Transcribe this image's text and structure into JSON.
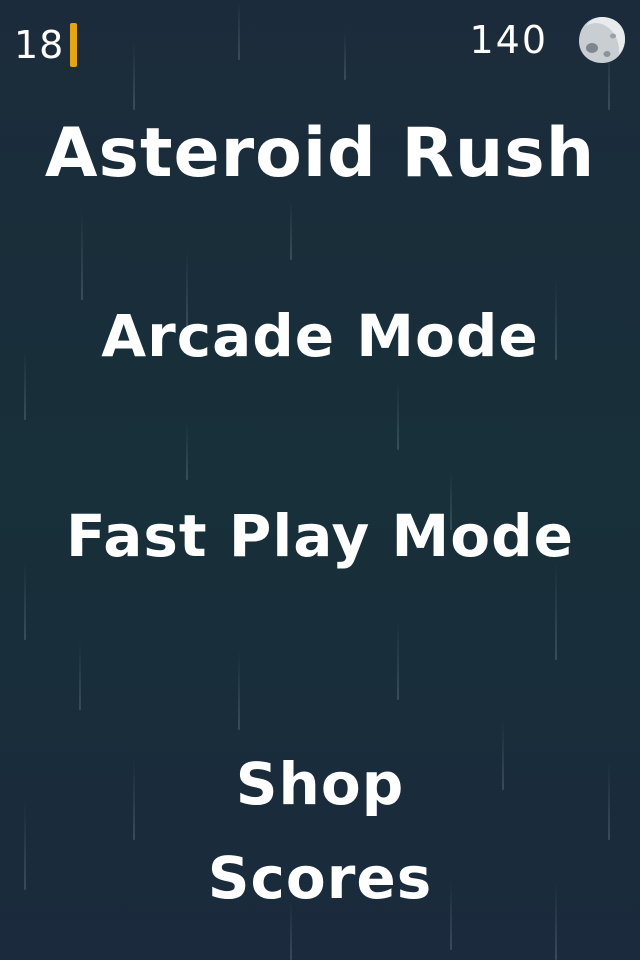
{
  "hud": {
    "level": "18",
    "coins": "140",
    "coin_icon": "asteroid-icon",
    "accent_color": "#e6a412"
  },
  "title": "Asteroid Rush",
  "menu": {
    "arcade": "Arcade Mode",
    "fast_play": "Fast Play Mode",
    "shop": "Shop",
    "scores": "Scores"
  },
  "colors": {
    "background": "#17303a",
    "text": "#ffffff"
  }
}
